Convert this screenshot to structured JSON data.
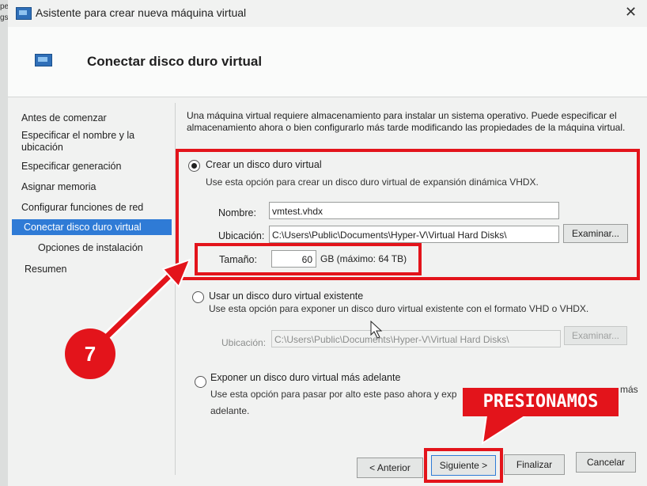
{
  "edge": {
    "top_text": "pe",
    "mid_text": "gs"
  },
  "window": {
    "title": "Asistente para crear nueva máquina virtual",
    "close_label": "✕",
    "page_title": "Conectar disco duro virtual"
  },
  "nav": {
    "items": [
      {
        "label": "Antes de comenzar"
      },
      {
        "label": "Especificar el nombre y la ubicación"
      },
      {
        "label": "Especificar generación"
      },
      {
        "label": "Asignar memoria"
      },
      {
        "label": "Configurar funciones de red"
      },
      {
        "label": "Conectar disco duro virtual",
        "selected": true
      },
      {
        "label": "Opciones de instalación"
      },
      {
        "label": "Resumen"
      }
    ]
  },
  "content": {
    "intro": "Una máquina virtual requiere almacenamiento para instalar un sistema operativo. Puede especificar el almacenamiento ahora o bien configurarlo más tarde modificando las propiedades de la máquina virtual.",
    "option_create": {
      "label": "Crear un disco duro virtual",
      "selected": true,
      "description": "Use esta opción para crear un disco duro virtual de expansión dinámica VHDX.",
      "name_label": "Nombre:",
      "name_value": "vmtest.vhdx",
      "location_label": "Ubicación:",
      "location_value": "C:\\Users\\Public\\Documents\\Hyper-V\\Virtual Hard Disks\\",
      "browse_label": "Examinar...",
      "size_label": "Tamaño:",
      "size_value": "60",
      "size_unit": "GB (máximo: 64 TB)"
    },
    "option_existing": {
      "label": "Usar un disco duro virtual existente",
      "selected": false,
      "description": "Use esta opción para exponer un disco duro virtual existente con el formato VHD o VHDX.",
      "location_label": "Ubicación:",
      "location_value": "C:\\Users\\Public\\Documents\\Hyper-V\\Virtual Hard Disks\\",
      "browse_label": "Examinar..."
    },
    "option_later": {
      "label": "Exponer un disco duro virtual más adelante",
      "selected": false,
      "description_line1": "Use esta opción para pasar por alto este paso ahora y exp",
      "description_tail": "más",
      "description_line2": "adelante."
    }
  },
  "buttons": {
    "back": "< Anterior",
    "next": "Siguiente >",
    "finish": "Finalizar",
    "cancel": "Cancelar"
  },
  "annotations": {
    "step_number": "7",
    "banner": "PRESIONAMOS",
    "accent_color": "#e3141b"
  }
}
